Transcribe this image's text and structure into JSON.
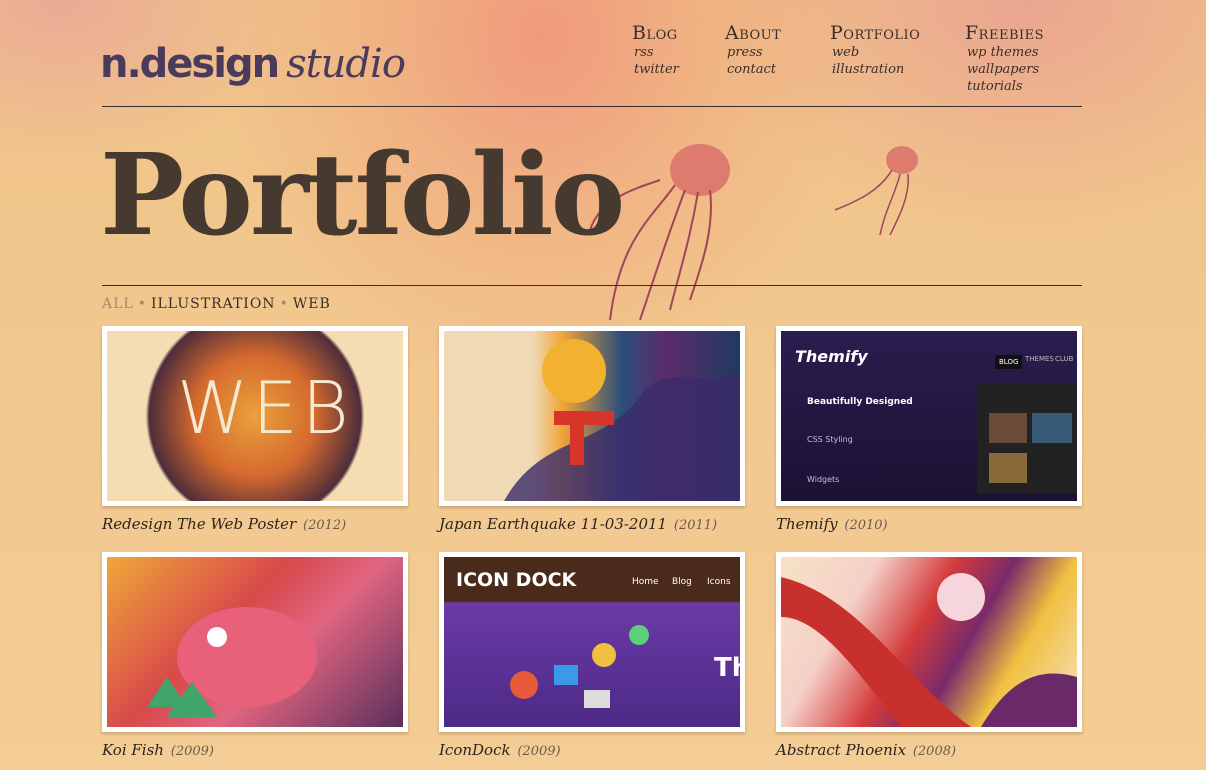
{
  "logo": {
    "main": "n.design",
    "studio": "studio"
  },
  "nav": [
    {
      "title": "Blog",
      "items": [
        "rss",
        "twitter"
      ]
    },
    {
      "title": "About",
      "items": [
        "press",
        "contact"
      ]
    },
    {
      "title": "Portfolio",
      "items": [
        "web",
        "illustration"
      ]
    },
    {
      "title": "Freebies",
      "items": [
        "wp themes",
        "wallpapers",
        "tutorials"
      ]
    }
  ],
  "headline": "Portfolio",
  "filters": [
    {
      "label": "ALL",
      "active": true
    },
    {
      "label": "ILLUSTRATION",
      "active": false
    },
    {
      "label": "WEB",
      "active": false
    }
  ],
  "filter_separator": "•",
  "projects": [
    {
      "title": "Redesign The Web Poster",
      "year": "(2012)",
      "art": "WEB"
    },
    {
      "title": "Japan Earthquake 11-03-2011",
      "year": "(2011)",
      "art": ""
    },
    {
      "title": "Themify",
      "year": "(2010)",
      "art": "Themify"
    },
    {
      "title": "Koi Fish",
      "year": "(2009)",
      "art": ""
    },
    {
      "title": "IconDock",
      "year": "(2009)",
      "art": "ICON DOCK"
    },
    {
      "title": "Abstract Phoenix",
      "year": "(2008)",
      "art": ""
    }
  ],
  "themify_thumb": {
    "tabs": [
      "BLOG",
      "THEMES",
      "CLUB"
    ],
    "heading": "Beautifully Designed",
    "items": [
      "CSS Styling",
      "Widgets"
    ]
  },
  "icondock_thumb": {
    "tabs": [
      "Home",
      "Blog",
      "Icons"
    ],
    "hero": "Th"
  },
  "colors": {
    "background": "#f2c98e",
    "ink": "#3a2f28",
    "logo": "#4a3b5c",
    "muted": "#a58a6e"
  }
}
